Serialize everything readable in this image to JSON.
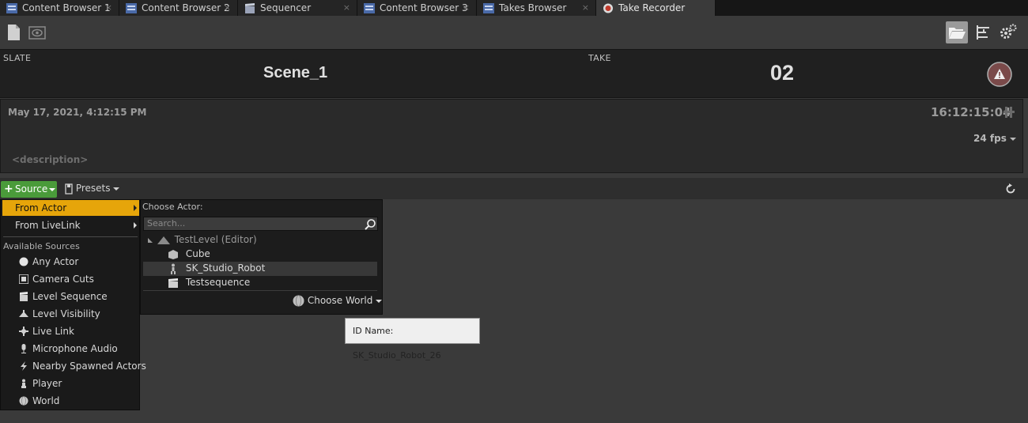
{
  "tabs": [
    {
      "label": "Content Browser 1",
      "icon": "content-browser-icon",
      "close": "×"
    },
    {
      "label": "Content Browser 2",
      "icon": "content-browser-icon",
      "close": "×"
    },
    {
      "label": "Sequencer",
      "icon": "sequencer-icon",
      "close": "×"
    },
    {
      "label": "Content Browser 3",
      "icon": "content-browser-icon",
      "close": "×"
    },
    {
      "label": "Takes Browser",
      "icon": "content-browser-icon",
      "close": "×"
    },
    {
      "label": "Take Recorder",
      "icon": "record-icon",
      "close": "×"
    }
  ],
  "slate": {
    "slate_label": "SLATE",
    "slate_value": "Scene_1",
    "take_label": "TAKE",
    "take_value": "02"
  },
  "info": {
    "date": "May 17, 2021, 4:12:15 PM",
    "timecode": "16:12:15:04",
    "fps": "24 fps",
    "description_placeholder": "<description>"
  },
  "sources_bar": {
    "source_label": "Source",
    "presets_label": "Presets"
  },
  "context_menu": {
    "from_actor": "From Actor",
    "from_livelink": "From LiveLink",
    "section_label": "Available Sources",
    "sources": [
      {
        "label": "Any Actor",
        "icon": "sphere-icon"
      },
      {
        "label": "Camera Cuts",
        "icon": "camera-cuts-icon"
      },
      {
        "label": "Level Sequence",
        "icon": "clapper-icon"
      },
      {
        "label": "Level Visibility",
        "icon": "level-visibility-icon"
      },
      {
        "label": "Live Link",
        "icon": "livelink-icon"
      },
      {
        "label": "Microphone Audio",
        "icon": "microphone-icon"
      },
      {
        "label": "Nearby Spawned Actors",
        "icon": "lightning-icon"
      },
      {
        "label": "Player",
        "icon": "player-icon"
      },
      {
        "label": "World",
        "icon": "world-icon"
      }
    ]
  },
  "actor_picker": {
    "heading": "Choose Actor:",
    "search_placeholder": "Search...",
    "level": "TestLevel (Editor)",
    "items": [
      {
        "label": "Cube",
        "icon": "static-mesh-actor-icon"
      },
      {
        "label": "SK_Studio_Robot",
        "icon": "skeletal-mesh-icon"
      },
      {
        "label": "Testsequence",
        "icon": "clapper-icon"
      }
    ],
    "choose_world": "Choose World"
  },
  "tooltip": {
    "text": "ID Name: SK_Studio_Robot_26"
  },
  "colors": {
    "accent_highlight": "#e6a50a",
    "source_button": "#4a9b3a",
    "record_red": "#c0392b",
    "warning_circle": "#7a4a4a"
  }
}
